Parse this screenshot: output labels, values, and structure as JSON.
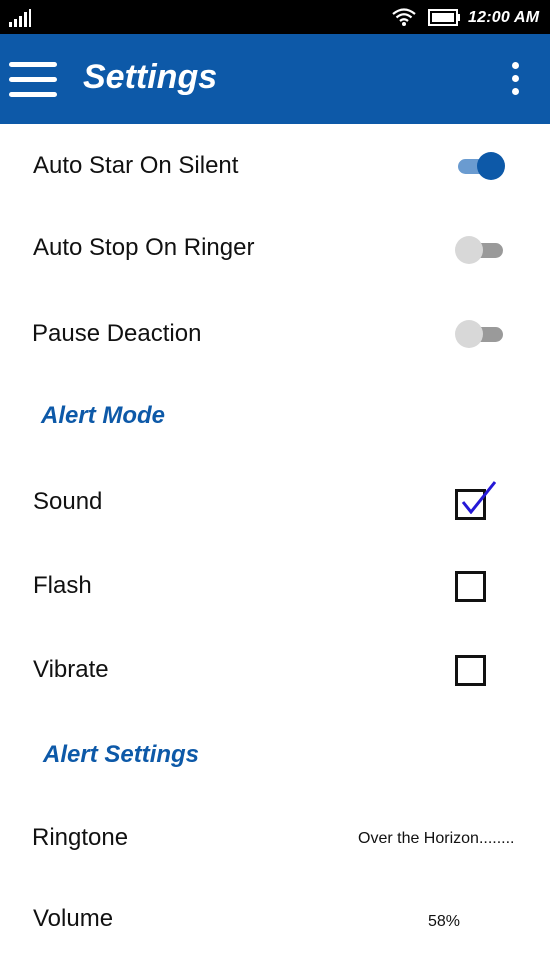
{
  "status_bar": {
    "time": "12:00 AM",
    "icons": [
      "signal-icon",
      "wifi-icon",
      "battery-icon"
    ]
  },
  "app_bar": {
    "title": "Settings",
    "menu_icon": "hamburger-menu-icon",
    "overflow_icon": "overflow-menu-icon",
    "color": "#0d59a8"
  },
  "settings": {
    "toggles": [
      {
        "label": "Auto Star On Silent",
        "on": true
      },
      {
        "label": "Auto Stop On Ringer",
        "on": false
      },
      {
        "label": "Pause Deaction",
        "on": false
      }
    ],
    "alert_mode": {
      "header": "Alert Mode",
      "options": [
        {
          "label": "Sound",
          "checked": true
        },
        {
          "label": "Flash",
          "checked": false
        },
        {
          "label": "Vibrate",
          "checked": false
        }
      ]
    },
    "alert_settings": {
      "header": "Alert Settings",
      "ringtone": {
        "label": "Ringtone",
        "value": "Over the Horizon........"
      },
      "volume": {
        "label": "Volume",
        "value": "58%"
      }
    }
  }
}
